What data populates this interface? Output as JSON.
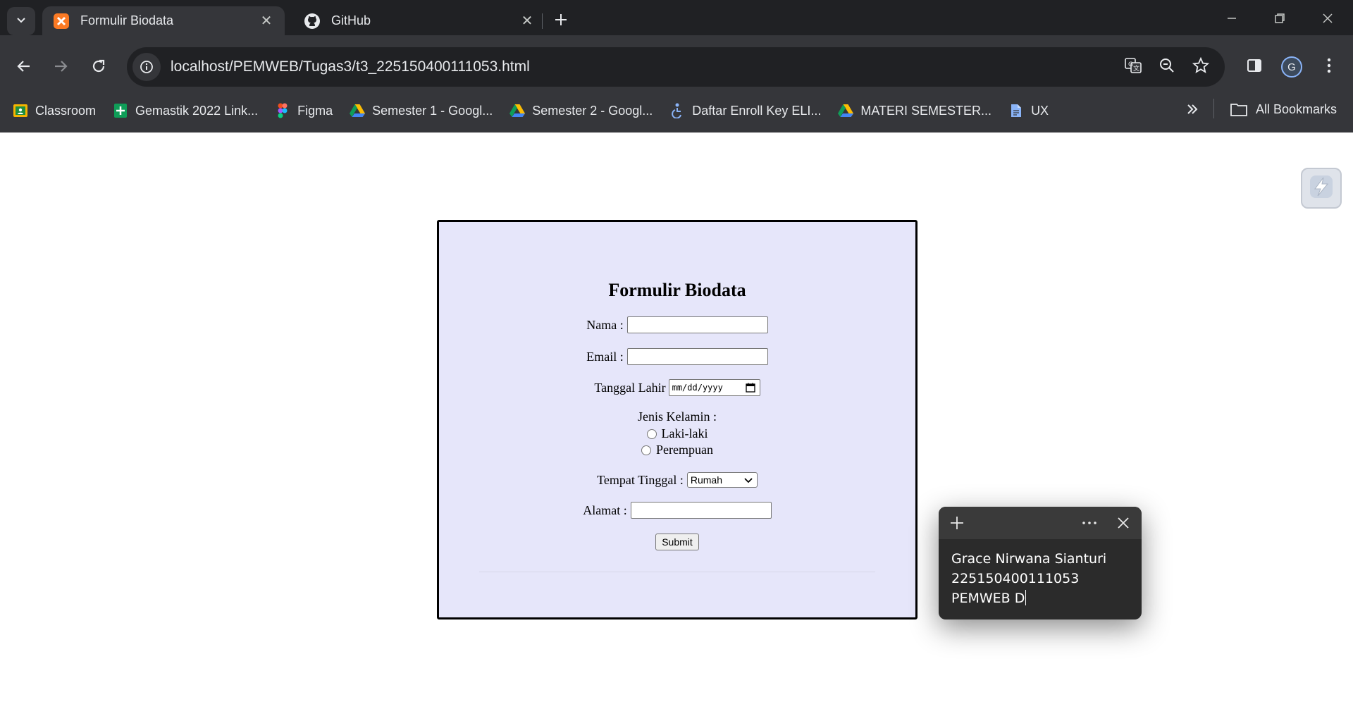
{
  "browser": {
    "tabs": [
      {
        "title": "Formulir Biodata",
        "icon": "xampp-icon",
        "active": true
      },
      {
        "title": "GitHub",
        "icon": "github-icon",
        "active": false
      }
    ],
    "url": "localhost/PEMWEB/Tugas3/t3_225150400111053.html",
    "profile_initial": "G",
    "bookmarks": [
      {
        "label": "Classroom",
        "icon": "classroom-icon"
      },
      {
        "label": "Gemastik 2022 Link...",
        "icon": "sheets-icon"
      },
      {
        "label": "Figma",
        "icon": "figma-icon"
      },
      {
        "label": "Semester 1 - Googl...",
        "icon": "drive-icon"
      },
      {
        "label": "Semester 2 - Googl...",
        "icon": "drive-icon"
      },
      {
        "label": "Daftar Enroll Key ELI...",
        "icon": "accessibility-icon"
      },
      {
        "label": "MATERI SEMESTER...",
        "icon": "drive-icon"
      },
      {
        "label": "UX",
        "icon": "doc-icon"
      }
    ],
    "all_bookmarks_label": "All Bookmarks"
  },
  "form": {
    "title": "Formulir Biodata",
    "nama_label": "Nama :",
    "email_label": "Email :",
    "tanggal_label": "Tanggal Lahir",
    "date_placeholder": "mm/dd/yyyy",
    "gender_label": "Jenis Kelamin :",
    "gender_options": [
      "Laki-laki",
      "Perempuan"
    ],
    "tempat_label": "Tempat Tinggal :",
    "tempat_selected": "Rumah",
    "alamat_label": "Alamat :",
    "submit_label": "Submit"
  },
  "sticky_note": {
    "lines": [
      "Grace Nirwana Sianturi",
      "225150400111053",
      "PEMWEB D"
    ]
  },
  "colors": {
    "form_background": "#e6e6fa",
    "chrome_dark": "#202124",
    "chrome_toolbar": "#35363a",
    "sticky_background": "#2b2b2b"
  }
}
